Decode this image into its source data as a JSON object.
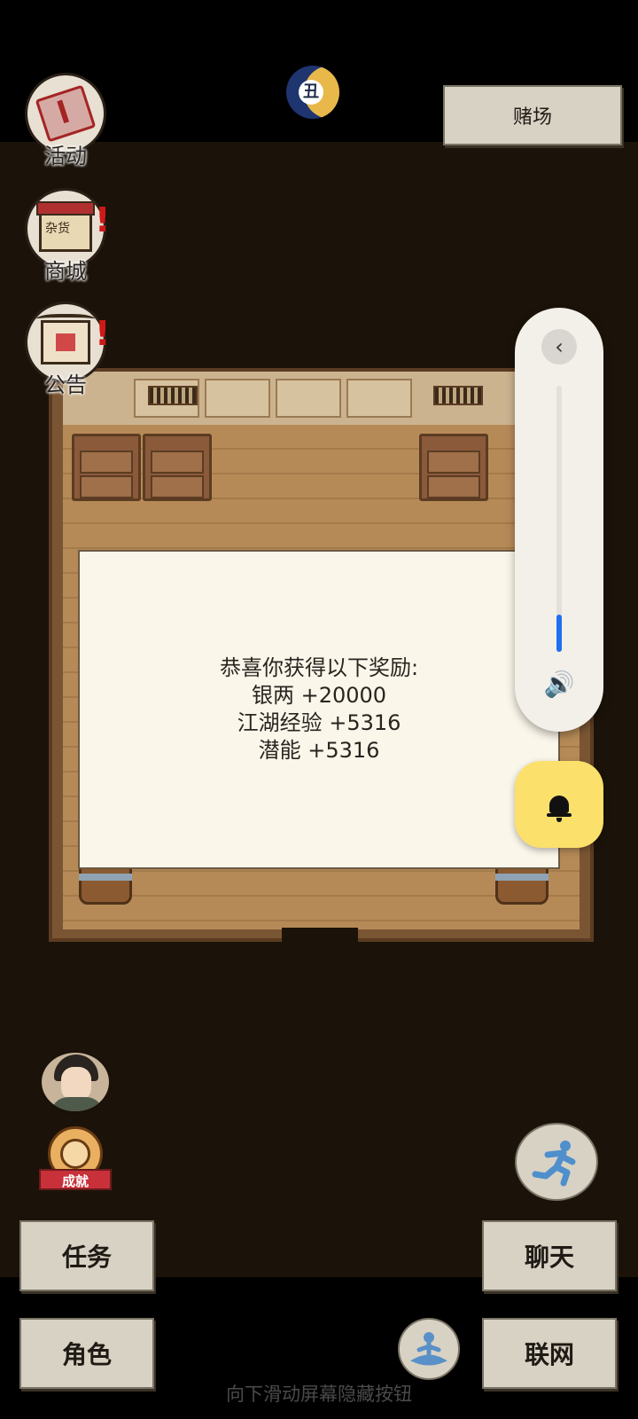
{
  "top": {
    "casino_label": "赌场",
    "time_icon": "moon-clock-icon",
    "time_symbol": "丑"
  },
  "side": {
    "activity_label": "活动",
    "shop_label": "商城",
    "shop_sign": "杂货",
    "notice_label": "公告",
    "alert_mark": "!"
  },
  "dialog": {
    "title": "恭喜你获得以下奖励:",
    "rewards": [
      "银两 +20000",
      "江湖经验 +5316",
      "潜能 +5316"
    ]
  },
  "volume": {
    "level": 0.14,
    "accent": "#1f6ff0"
  },
  "bottom": {
    "achievement_label": "成就",
    "task_label": "任务",
    "character_label": "角色",
    "chat_label": "聊天",
    "network_label": "联网",
    "gesture_hint": "向下滑动屏幕隐藏按钮"
  }
}
